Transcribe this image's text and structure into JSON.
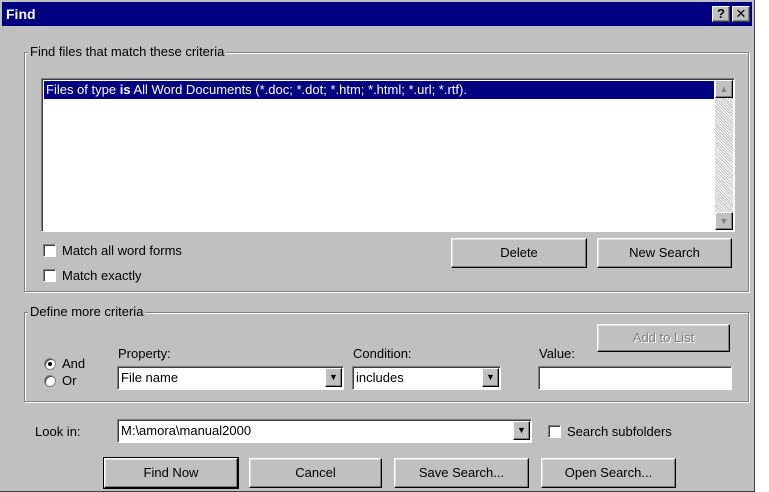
{
  "dialog": {
    "title": "Find",
    "help_label": "?",
    "close_label": "✕"
  },
  "criteria": {
    "legend": "Find files that match these criteria",
    "legend_key": "t",
    "list_items": [
      "Files of type is All Word Documents (*.doc; *.dot; *.htm; *.html; *.url; *.rtf)."
    ],
    "list_item_prefix": "Files of type ",
    "list_item_bold": "is",
    "list_item_suffix": " All Word Documents (*.doc; *.dot; *.htm; *.html; *.url; *.rtf).",
    "match_all_word_forms": {
      "label": "Match all word forms",
      "checked": false
    },
    "match_exactly": {
      "label": "Match exactly",
      "checked": false
    },
    "delete_label": "Delete",
    "new_search_label": "New Search"
  },
  "define": {
    "legend": "Define more criteria",
    "add_to_list_label": "Add to List",
    "and_label": "And",
    "or_label": "Or",
    "selected_logic": "And",
    "property_label": "Property:",
    "property_value": "File name",
    "condition_label": "Condition:",
    "condition_value": "includes",
    "value_label": "Value:",
    "value_text": ""
  },
  "look_in": {
    "label": "Look in:",
    "value": "M:\\amora\\manual2000",
    "search_subfolders": {
      "label": "Search subfolders",
      "checked": false
    }
  },
  "buttons": {
    "find_now": "Find Now",
    "cancel": "Cancel",
    "save_search": "Save Search...",
    "open_search": "Open Search..."
  },
  "icons": {
    "scroll_up": "scroll-up-arrow-icon",
    "scroll_down": "scroll-down-arrow-icon",
    "dropdown": "chevron-down-icon"
  }
}
